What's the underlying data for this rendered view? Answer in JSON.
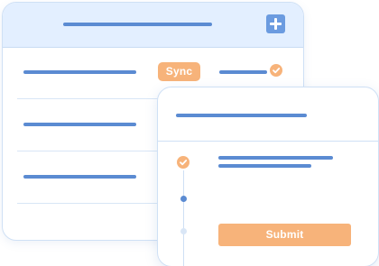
{
  "back_card": {
    "sync_button_label": "Sync",
    "add_icon": "plus-icon",
    "status_icon": "checkmark-icon"
  },
  "front_card": {
    "submit_button_label": "Submit",
    "timeline": [
      {
        "state": "done",
        "icon": "checkmark-icon"
      },
      {
        "state": "active",
        "icon": "dot"
      },
      {
        "state": "pending",
        "icon": "dot"
      }
    ]
  },
  "colors": {
    "accent_blue": "#5b8bd2",
    "accent_orange": "#f7b37a",
    "header_blue": "#e3efff",
    "border": "#cfe0f5"
  }
}
